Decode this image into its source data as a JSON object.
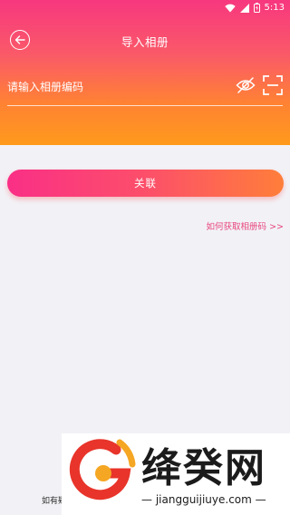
{
  "status_bar": {
    "time": "5:13",
    "icons": [
      "wifi-icon",
      "signal-icon",
      "battery-icon"
    ]
  },
  "header": {
    "title": "导入相册",
    "back_icon": "back-arrow-icon"
  },
  "form": {
    "code_placeholder": "请输入相册编码",
    "code_value": "",
    "visibility_icon": "eye-hidden-icon",
    "scan_icon": "scan-icon"
  },
  "actions": {
    "link_label": "关联",
    "help_link": "如何获取相册码 >>"
  },
  "footer": {
    "text": "如有疑"
  },
  "watermark": {
    "title": "绛癸网",
    "url": "jiangguijiuye.com"
  },
  "colors": {
    "gradient_top": "#f7377f",
    "gradient_bottom": "#ff9a1c",
    "accent_pink": "#e8467e",
    "background": "#f2f2f6"
  }
}
